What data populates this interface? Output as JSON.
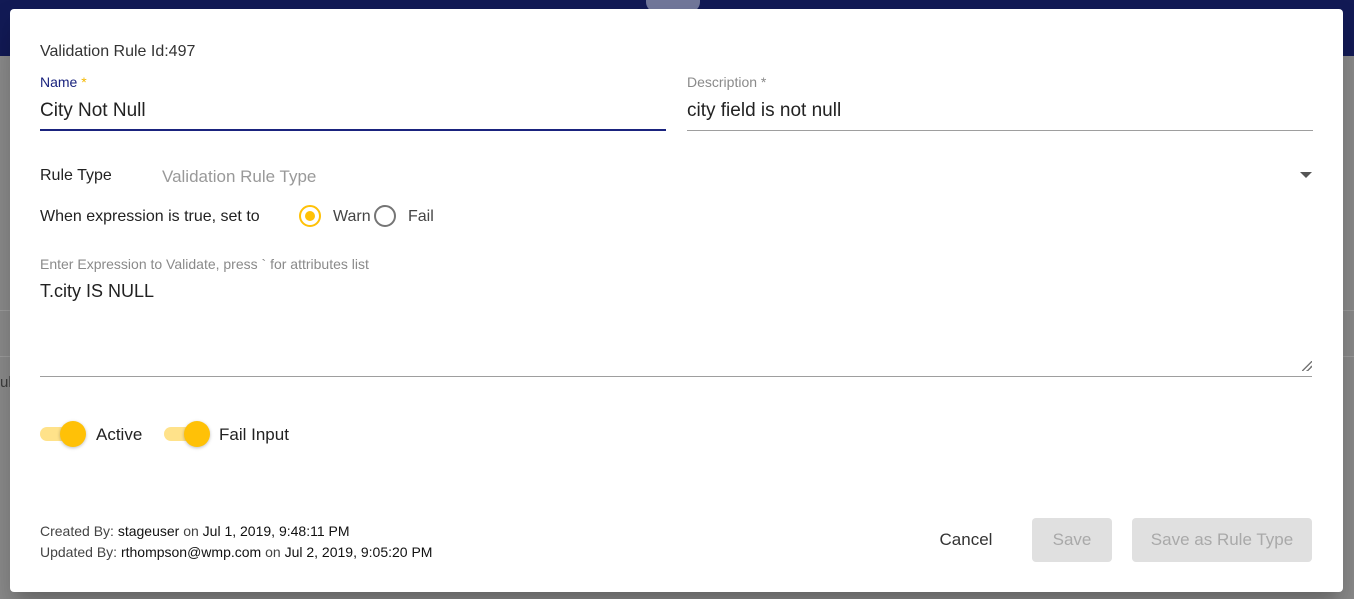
{
  "backdrop": {
    "partial_text": "ul"
  },
  "dialog": {
    "rule_id_text": "Validation Rule Id:497",
    "name": {
      "label": "Name",
      "required_mark": "*",
      "value": "City Not Null"
    },
    "description": {
      "label": "Description",
      "required_mark": "*",
      "value": "city field is not null"
    },
    "rule_type": {
      "label": "Rule Type",
      "placeholder": "Validation Rule Type"
    },
    "expression_result": {
      "label": "When expression is true, set to",
      "options": [
        {
          "label": "Warn",
          "checked": true
        },
        {
          "label": "Fail",
          "checked": false
        }
      ]
    },
    "expression": {
      "caption": "Enter Expression to Validate, press ` for attributes list",
      "value": "T.city IS NULL"
    },
    "toggles": [
      {
        "label": "Active",
        "on": true
      },
      {
        "label": "Fail Input",
        "on": true
      }
    ],
    "audit": {
      "created_prefix": "Created By:",
      "created_user": "stageuser",
      "created_on": "on",
      "created_date": "Jul 1, 2019, 9:48:11 PM",
      "updated_prefix": "Updated By:",
      "updated_user": "rthompson@wmp.com",
      "updated_on": "on",
      "updated_date": "Jul 2, 2019, 9:05:20 PM"
    },
    "buttons": {
      "cancel": "Cancel",
      "save": "Save",
      "save_as_rule_type": "Save as Rule Type"
    }
  },
  "colors": {
    "accent": "#ffc107",
    "primary": "#1a237e",
    "header": "#121a55"
  }
}
